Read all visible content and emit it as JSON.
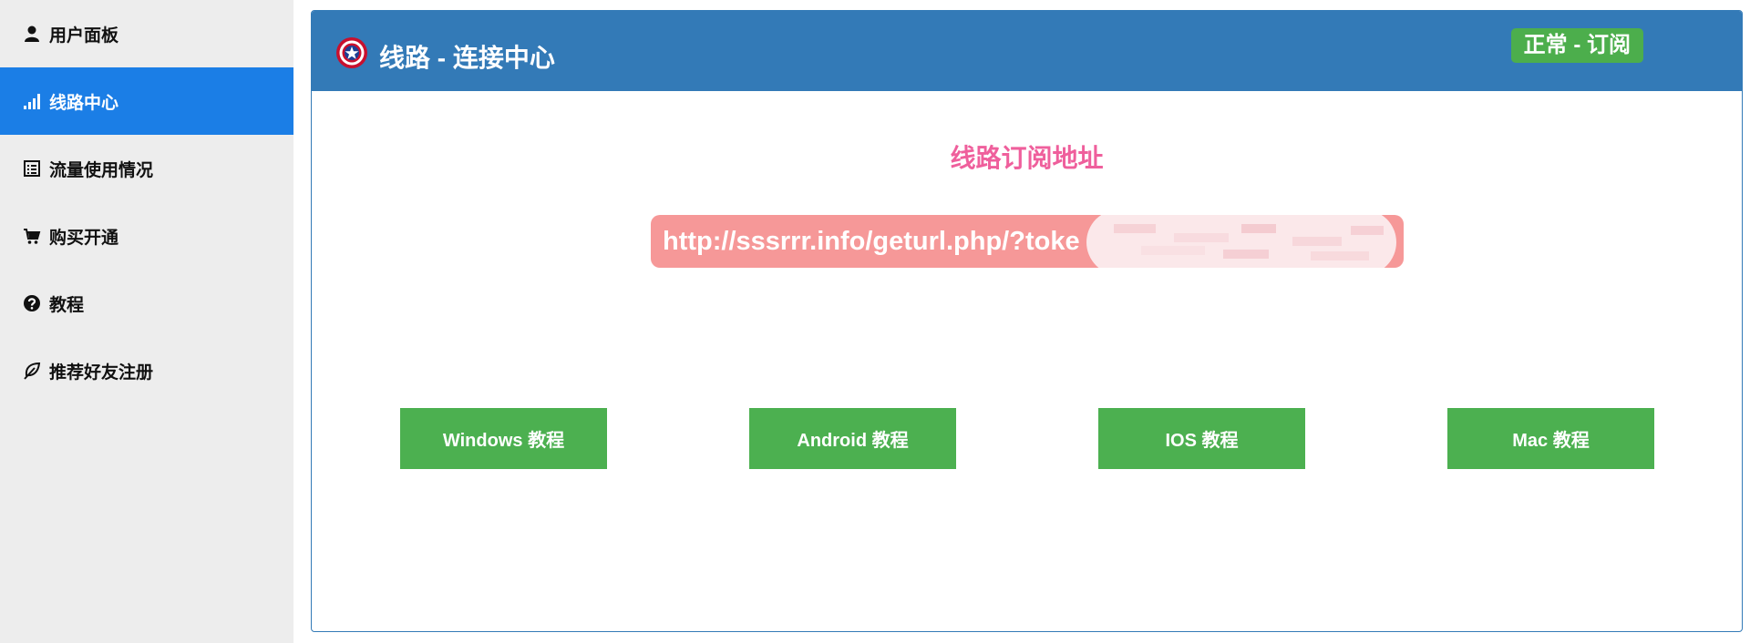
{
  "sidebar": {
    "items": [
      {
        "label": "用户面板",
        "icon": "user-icon",
        "active": false
      },
      {
        "label": "线路中心",
        "icon": "signal-icon",
        "active": true
      },
      {
        "label": "流量使用情况",
        "icon": "list-icon",
        "active": false
      },
      {
        "label": "购买开通",
        "icon": "cart-icon",
        "active": false
      },
      {
        "label": "教程",
        "icon": "question-icon",
        "active": false
      },
      {
        "label": "推荐好友注册",
        "icon": "leaf-icon",
        "active": false
      }
    ]
  },
  "panel": {
    "title": "线路 - 连接中心",
    "logo_icon": "star-shield-icon",
    "status_badge": "正常 - 订阅",
    "subscription_heading": "线路订阅地址",
    "subscription_url": "http://sssrrr.info/geturl.php/?toke"
  },
  "tutorials": [
    {
      "label": "Windows 教程"
    },
    {
      "label": "Android 教程"
    },
    {
      "label": "IOS 教程"
    },
    {
      "label": "Mac 教程"
    }
  ],
  "colors": {
    "sidebar_active": "#1b7ee6",
    "panel_header": "#337ab7",
    "status_badge": "#4cae4c",
    "subscription_heading": "#ef5f9c",
    "url_box": "#f69898",
    "tutorial_button": "#4cb050"
  }
}
